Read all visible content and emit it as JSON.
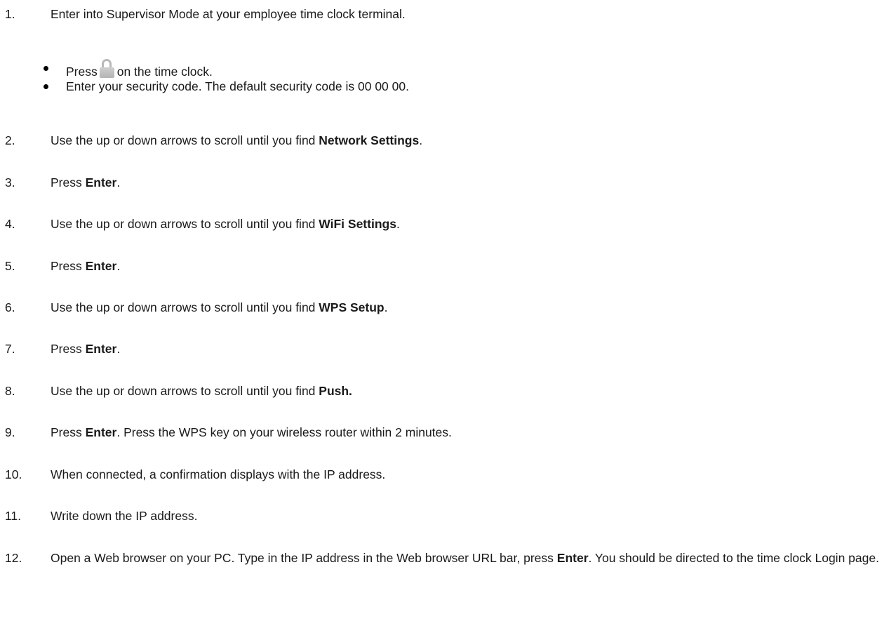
{
  "steps": [
    {
      "num": "1.",
      "text": "Enter into Supervisor Mode at your employee time clock terminal."
    },
    {
      "num": "2.",
      "pre": "Use the up or down arrows to scroll until you find ",
      "bold": "Network Settings",
      "post": "."
    },
    {
      "num": "3.",
      "pre": "Press ",
      "bold": "Enter",
      "post": "."
    },
    {
      "num": "4.",
      "pre": "Use the up or down arrows to scroll until you find ",
      "bold": "WiFi Settings",
      "post": "."
    },
    {
      "num": "5.",
      "pre": "Press ",
      "bold": "Enter",
      "post": "."
    },
    {
      "num": "6.",
      "pre": "Use the up or down arrows to scroll until you find ",
      "bold": "WPS Setup",
      "post": "."
    },
    {
      "num": "7.",
      "pre": "Press ",
      "bold": "Enter",
      "post": "."
    },
    {
      "num": "8.",
      "pre": "Use the up or down arrows to scroll until you find ",
      "bold": "Push."
    },
    {
      "num": "9.",
      "pre": "Press ",
      "bold": "Enter",
      "post": ". Press the WPS key on your wireless router within 2 minutes."
    },
    {
      "num": "10.",
      "text": "When connected, a confirmation displays with the IP address."
    },
    {
      "num": "11.",
      "text": "Write down the IP address."
    },
    {
      "num": "12.",
      "pre": "Open a Web browser on your PC. Type in the IP address in the Web browser URL bar, press ",
      "bold": "Enter",
      "post": ". You should be directed to the time clock Login page."
    }
  ],
  "bullets": [
    {
      "pre": "Press",
      "icon": "lock-icon",
      "post": "on the time clock."
    },
    {
      "text": "Enter your security code. The default security code is 00 00 00."
    }
  ]
}
